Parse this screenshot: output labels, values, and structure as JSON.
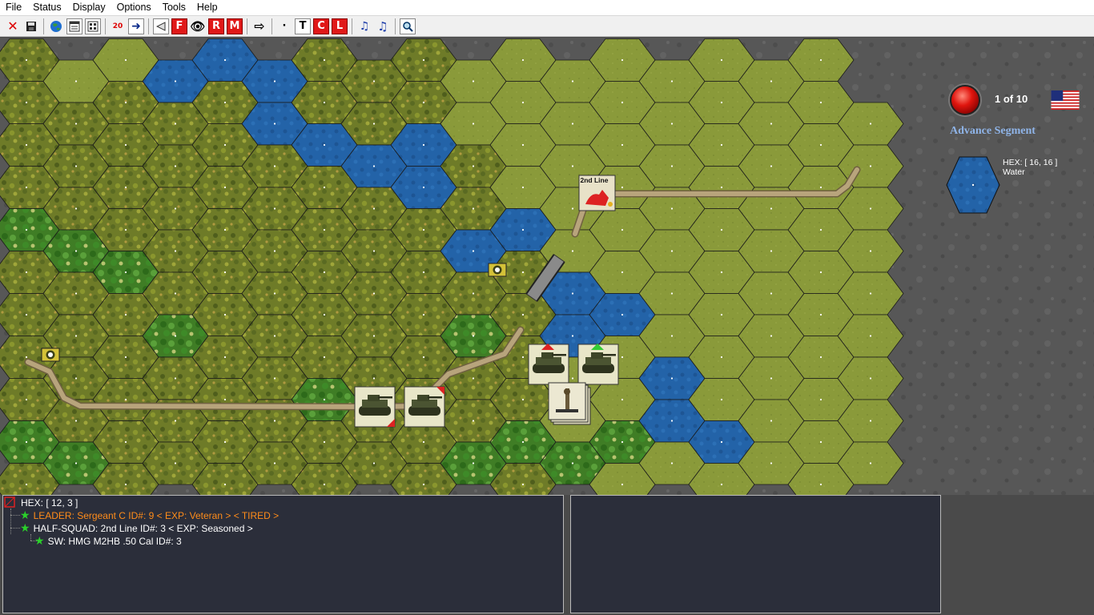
{
  "menu": [
    "File",
    "Status",
    "Display",
    "Options",
    "Tools",
    "Help"
  ],
  "toolbar": {
    "icons": [
      "close-icon",
      "save-icon",
      "globe-icon",
      "window-icon",
      "grid-icon",
      "dice-icon",
      "next-icon",
      "prev-icon",
      "fire-icon",
      "eye-icon",
      "rout-icon",
      "move-icon",
      "arrow-icon",
      "dot-icon",
      "text-icon",
      "c-icon",
      "l-icon",
      "sfx-icon",
      "music-icon",
      "zoom-icon"
    ],
    "labels": {
      "fire": "F",
      "rout": "R",
      "move": "M",
      "text": "T",
      "c": "C",
      "l": "L",
      "dice": "20",
      "dot": "·"
    }
  },
  "side": {
    "turn": "1 of 10",
    "phase": "Advance Segment",
    "hex_label": "HEX: [ 16, 16 ]",
    "terrain": "Water"
  },
  "map": {
    "counters": {
      "second_line_label": "2nd Line"
    },
    "colors": {
      "clear": "#8a9a3a",
      "woods": "#6e7b28",
      "water": "#2363a8",
      "road": "#b8a47c",
      "rock": "#575757"
    }
  },
  "stack": {
    "hex": "HEX: [ 12, 3 ]",
    "units": [
      {
        "text": "LEADER: Sergeant C   ID#: 9 < EXP: Veteran >  < TIRED >",
        "highlight": true
      },
      {
        "text": "HALF-SQUAD: 2nd Line   ID#: 3 < EXP: Seasoned >",
        "highlight": false
      },
      {
        "text": "SW: HMG M2HB .50 Cal  ID#: 3",
        "highlight": false
      }
    ]
  }
}
